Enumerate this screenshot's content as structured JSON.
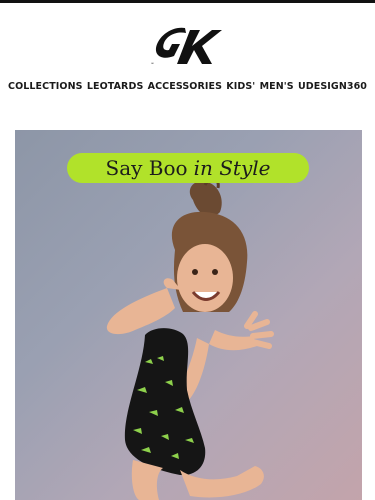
{
  "brand": {
    "logo_text": "GK"
  },
  "nav": {
    "items": [
      {
        "label": "COLLECTIONS"
      },
      {
        "label": "LEOTARDS"
      },
      {
        "label": "ACCESSORIES"
      },
      {
        "label": "KIDS'"
      },
      {
        "label": "MEN'S"
      },
      {
        "label": "UDESIGN360"
      }
    ]
  },
  "hero": {
    "headline_a": "Say Boo",
    "headline_b": "in Style",
    "pill_color": "#b1e22a",
    "image_icon": "girl-in-halloween-leotard-photo"
  }
}
